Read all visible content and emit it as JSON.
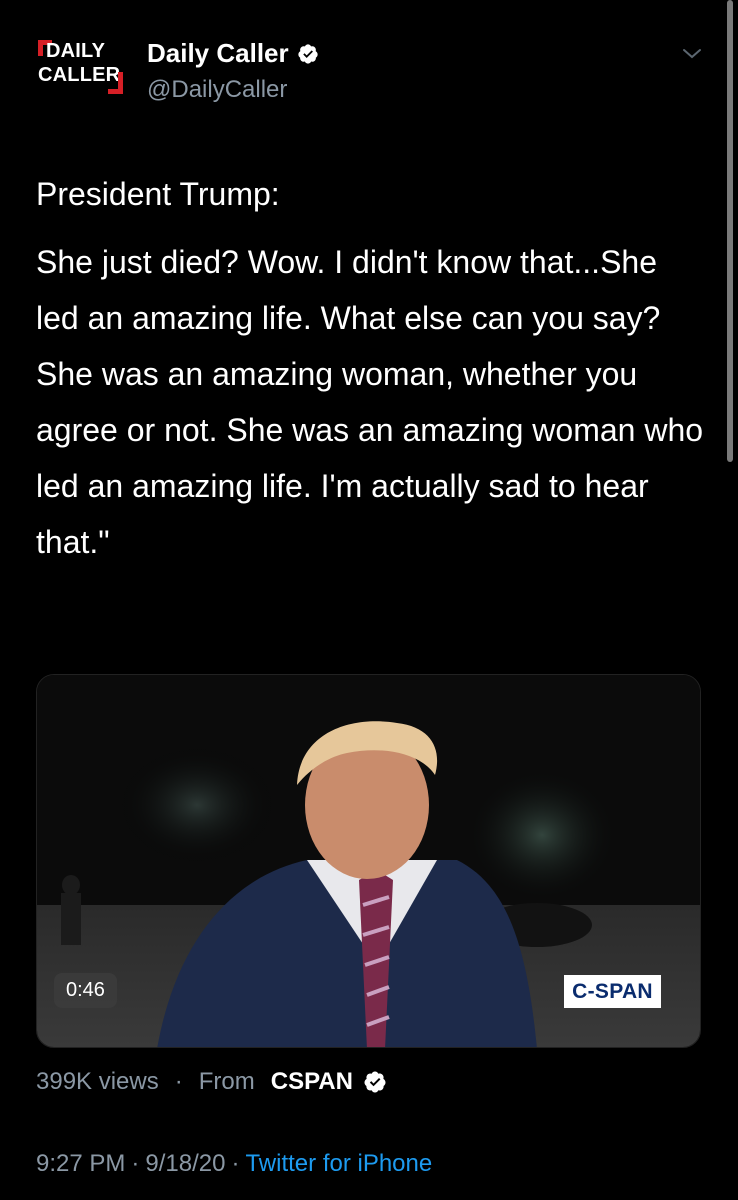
{
  "account": {
    "logo_line1": "DAILY",
    "logo_line2": "CALLER",
    "display_name": "Daily Caller",
    "handle": "@DailyCaller"
  },
  "tweet": {
    "paragraphs": [
      "President Trump:",
      "She just died? Wow. I didn't know that...She led an amazing life.  What else can you say? She was an amazing woman, whether you agree or not. She was an amazing woman who led an amazing life. I'm actually sad to hear that.\""
    ]
  },
  "media": {
    "duration": "0:46",
    "watermark": "C-SPAN"
  },
  "stats": {
    "views": "399K views",
    "separator": "·",
    "from_label": "From",
    "source": "CSPAN"
  },
  "meta": {
    "time": "9:27 PM",
    "date": "9/18/20",
    "separator": "·",
    "client": "Twitter for iPhone"
  },
  "colors": {
    "background": "#000000",
    "text": "#ffffff",
    "secondary_text": "#8b98a5",
    "link": "#1d9bf0",
    "brand_red": "#d61f26"
  },
  "icons": [
    "verified-badge-icon",
    "chevron-down-icon"
  ]
}
